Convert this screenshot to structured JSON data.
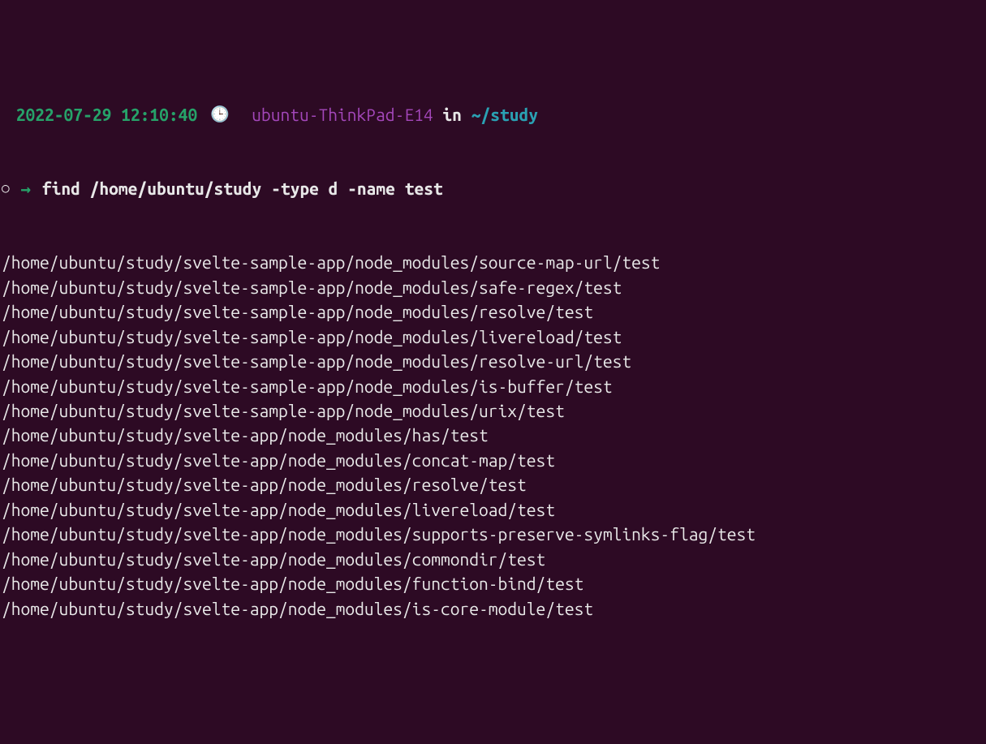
{
  "prompt": {
    "timestamp": " 2022-07-29 12:10:40",
    "clock_emoji": "🕒",
    "hostname": "ubuntu-ThinkPad-E14",
    "in_word": "in",
    "cwd": "~/study"
  },
  "command_line": {
    "circle": "○",
    "arrow": "→",
    "command": "find /home/ubuntu/study -type d -name test"
  },
  "output": [
    "/home/ubuntu/study/svelte-sample-app/node_modules/source-map-url/test",
    "/home/ubuntu/study/svelte-sample-app/node_modules/safe-regex/test",
    "/home/ubuntu/study/svelte-sample-app/node_modules/resolve/test",
    "/home/ubuntu/study/svelte-sample-app/node_modules/livereload/test",
    "/home/ubuntu/study/svelte-sample-app/node_modules/resolve-url/test",
    "/home/ubuntu/study/svelte-sample-app/node_modules/is-buffer/test",
    "/home/ubuntu/study/svelte-sample-app/node_modules/urix/test",
    "/home/ubuntu/study/svelte-app/node_modules/has/test",
    "/home/ubuntu/study/svelte-app/node_modules/concat-map/test",
    "/home/ubuntu/study/svelte-app/node_modules/resolve/test",
    "/home/ubuntu/study/svelte-app/node_modules/livereload/test",
    "/home/ubuntu/study/svelte-app/node_modules/supports-preserve-symlinks-flag/test",
    "/home/ubuntu/study/svelte-app/node_modules/commondir/test",
    "/home/ubuntu/study/svelte-app/node_modules/function-bind/test",
    "/home/ubuntu/study/svelte-app/node_modules/is-core-module/test"
  ]
}
